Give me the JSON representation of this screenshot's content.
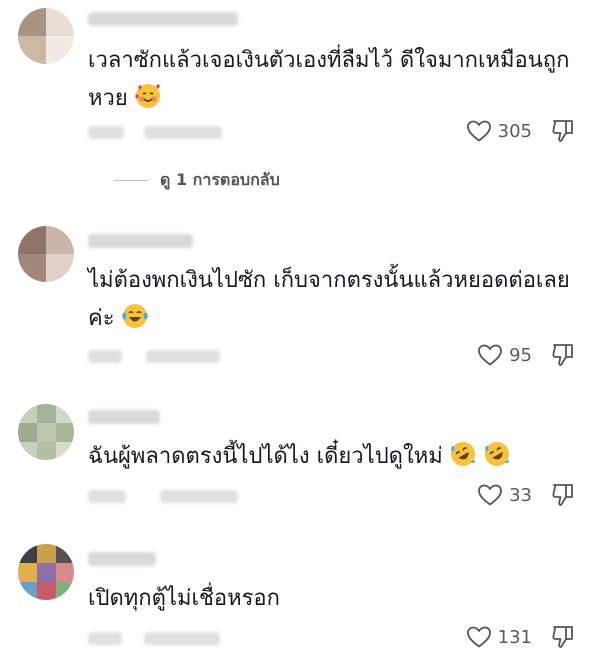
{
  "comments": [
    {
      "text": "เวลาซักแล้วเจอเงินตัวเองที่ลืมไว้ ดีใจมากเหมือนถูกหวย",
      "emoji_icon": "smiling-face-with-hearts",
      "likes": "305",
      "replies_label": "ดู 1 การตอบกลับ"
    },
    {
      "text": "ไม่ต้องพกเงินไปซัก เก็บจากตรงนั้นแล้วหยอดต่อเลยค่ะ",
      "emoji_icon": "face-with-tears-of-joy",
      "likes": "95"
    },
    {
      "text": "ฉันผู้พลาดตรงนี้ไปได้ไง เดี๋ยวไปดูใหม่",
      "emoji_icon": "rolling-on-floor-laughing",
      "likes": "33"
    },
    {
      "text": "เปิดทุกตู้ไม่เชื่อหรอก",
      "likes": "131"
    }
  ]
}
